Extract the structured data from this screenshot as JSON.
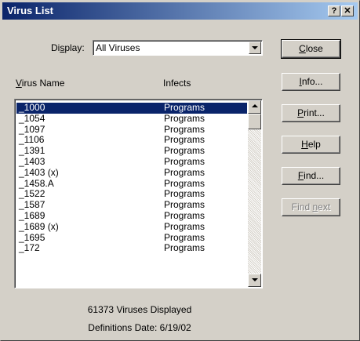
{
  "window": {
    "title": "Virus List",
    "help_glyph": "?",
    "close_glyph": "✕"
  },
  "display": {
    "label_pre": "Di",
    "label_mnemonic": "s",
    "label_post": "play:",
    "selected": "All Viruses"
  },
  "columns": {
    "name_mnemonic": "V",
    "name_rest": "irus Name",
    "infects": "Infects"
  },
  "viruses": [
    {
      "name": "_1000",
      "infects": "Programs",
      "selected": true
    },
    {
      "name": "_1054",
      "infects": "Programs"
    },
    {
      "name": "_1097",
      "infects": "Programs"
    },
    {
      "name": "_1106",
      "infects": "Programs"
    },
    {
      "name": "_1391",
      "infects": "Programs"
    },
    {
      "name": "_1403",
      "infects": "Programs"
    },
    {
      "name": "_1403 (x)",
      "infects": "Programs"
    },
    {
      "name": "_1458.A",
      "infects": "Programs"
    },
    {
      "name": "_1522",
      "infects": "Programs"
    },
    {
      "name": "_1587",
      "infects": "Programs"
    },
    {
      "name": "_1689",
      "infects": "Programs"
    },
    {
      "name": "_1689 (x)",
      "infects": "Programs"
    },
    {
      "name": "_1695",
      "infects": "Programs"
    },
    {
      "name": "_172",
      "infects": "Programs"
    }
  ],
  "buttons": {
    "close": {
      "mnemonic": "C",
      "rest": "lose"
    },
    "info": {
      "mnemonic": "I",
      "rest": "nfo..."
    },
    "print": {
      "mnemonic": "P",
      "rest": "rint..."
    },
    "help": {
      "mnemonic": "H",
      "rest": "elp"
    },
    "find": {
      "mnemonic": "F",
      "rest": "ind..."
    },
    "find_next": {
      "pre": "Find ",
      "mnemonic": "n",
      "rest": "ext"
    }
  },
  "status": {
    "count": "61373 Viruses Displayed",
    "definitions": "Definitions Date: 6/19/02"
  },
  "icons": {
    "dropdown": "chevron-down-icon",
    "scroll_up": "arrow-up-icon",
    "scroll_down": "arrow-down-icon"
  },
  "colors": {
    "title_start": "#0a246a",
    "title_end": "#a6caf0",
    "selection": "#0a246a",
    "face": "#d4d0c8"
  }
}
